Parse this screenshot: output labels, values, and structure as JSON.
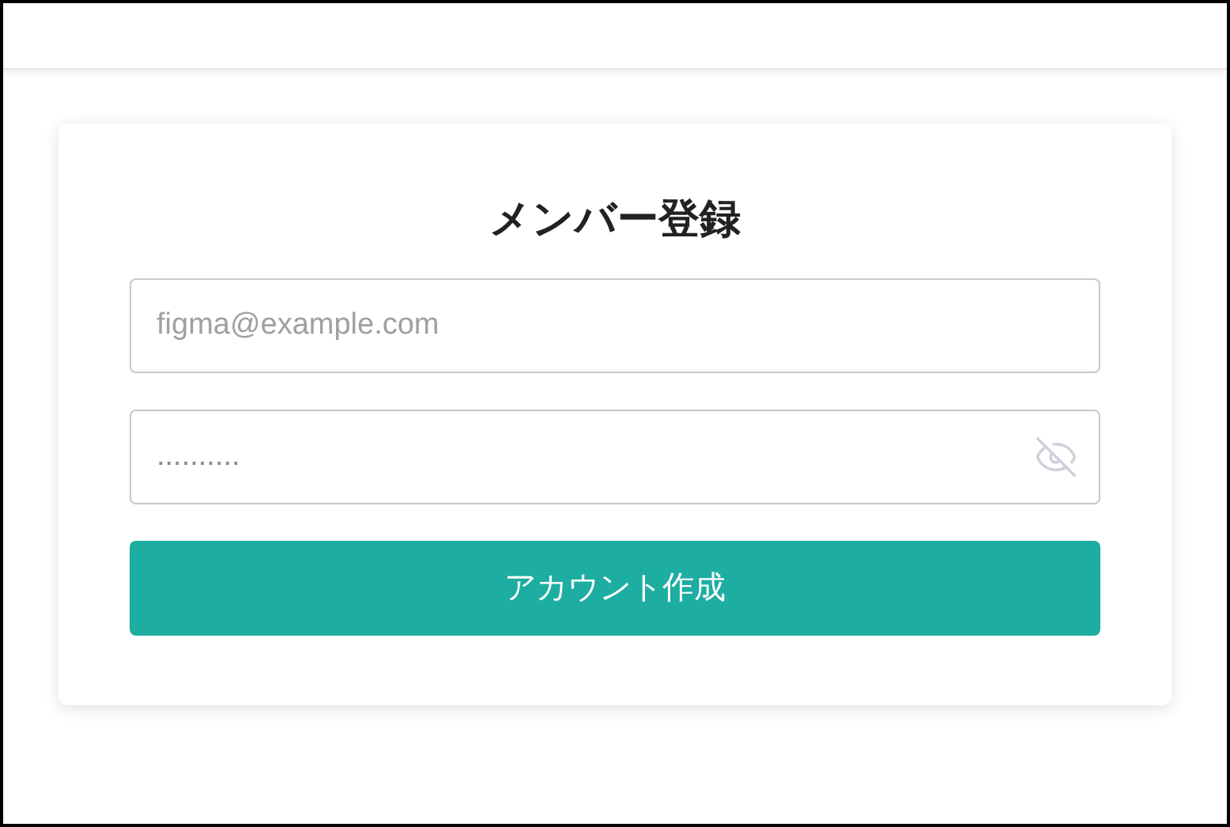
{
  "form": {
    "title": "メンバー登録",
    "email": {
      "placeholder": "figma@example.com"
    },
    "password": {
      "placeholder": "..........",
      "show_password": false
    },
    "submit": "アカウント作成"
  }
}
